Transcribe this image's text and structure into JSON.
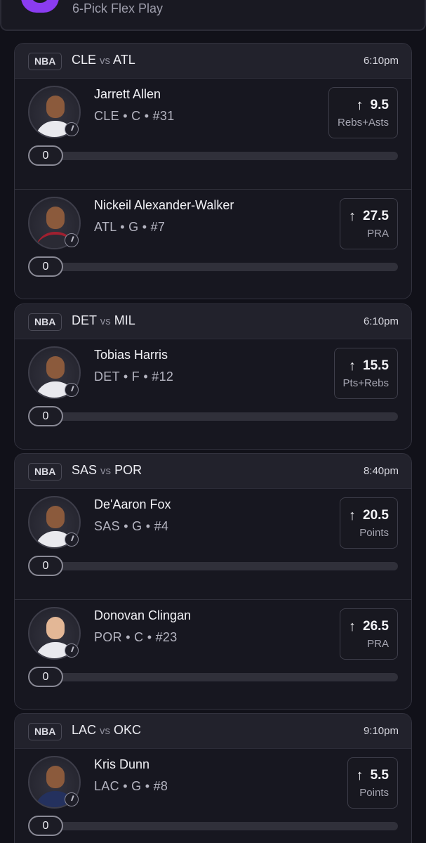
{
  "header": {
    "title": "6-Pick Flex Play"
  },
  "games": [
    {
      "league": "NBA",
      "home": "CLE",
      "vs": "vs",
      "away": "ATL",
      "time": "6:10pm",
      "players": [
        {
          "name": "Jarrett Allen",
          "meta": "CLE • C • #31",
          "line": "9.5",
          "stat": "Rebs+Asts",
          "direction": "up-arrow",
          "progress": "0"
        },
        {
          "name": "Nickeil Alexander-Walker",
          "meta": "ATL • G • #7",
          "line": "27.5",
          "stat": "PRA",
          "direction": "up-arrow",
          "progress": "0"
        }
      ]
    },
    {
      "league": "NBA",
      "home": "DET",
      "vs": "vs",
      "away": "MIL",
      "time": "6:10pm",
      "players": [
        {
          "name": "Tobias Harris",
          "meta": "DET • F • #12",
          "line": "15.5",
          "stat": "Pts+Rebs",
          "direction": "up-arrow",
          "progress": "0"
        }
      ]
    },
    {
      "league": "NBA",
      "home": "SAS",
      "vs": "vs",
      "away": "POR",
      "time": "8:40pm",
      "players": [
        {
          "name": "De'Aaron Fox",
          "meta": "SAS • G • #4",
          "line": "20.5",
          "stat": "Points",
          "direction": "up-arrow",
          "progress": "0"
        },
        {
          "name": "Donovan Clingan",
          "meta": "POR • C • #23",
          "line": "26.5",
          "stat": "PRA",
          "direction": "up-arrow",
          "progress": "0"
        }
      ]
    },
    {
      "league": "NBA",
      "home": "LAC",
      "vs": "vs",
      "away": "OKC",
      "time": "9:10pm",
      "players": [
        {
          "name": "Kris Dunn",
          "meta": "LAC • G • #8",
          "line": "5.5",
          "stat": "Points",
          "direction": "up-arrow",
          "progress": "0"
        }
      ]
    }
  ],
  "colors": {
    "background": "#111119",
    "card": "#171720",
    "header": "#22222c",
    "brand": "#8a3cf0"
  }
}
